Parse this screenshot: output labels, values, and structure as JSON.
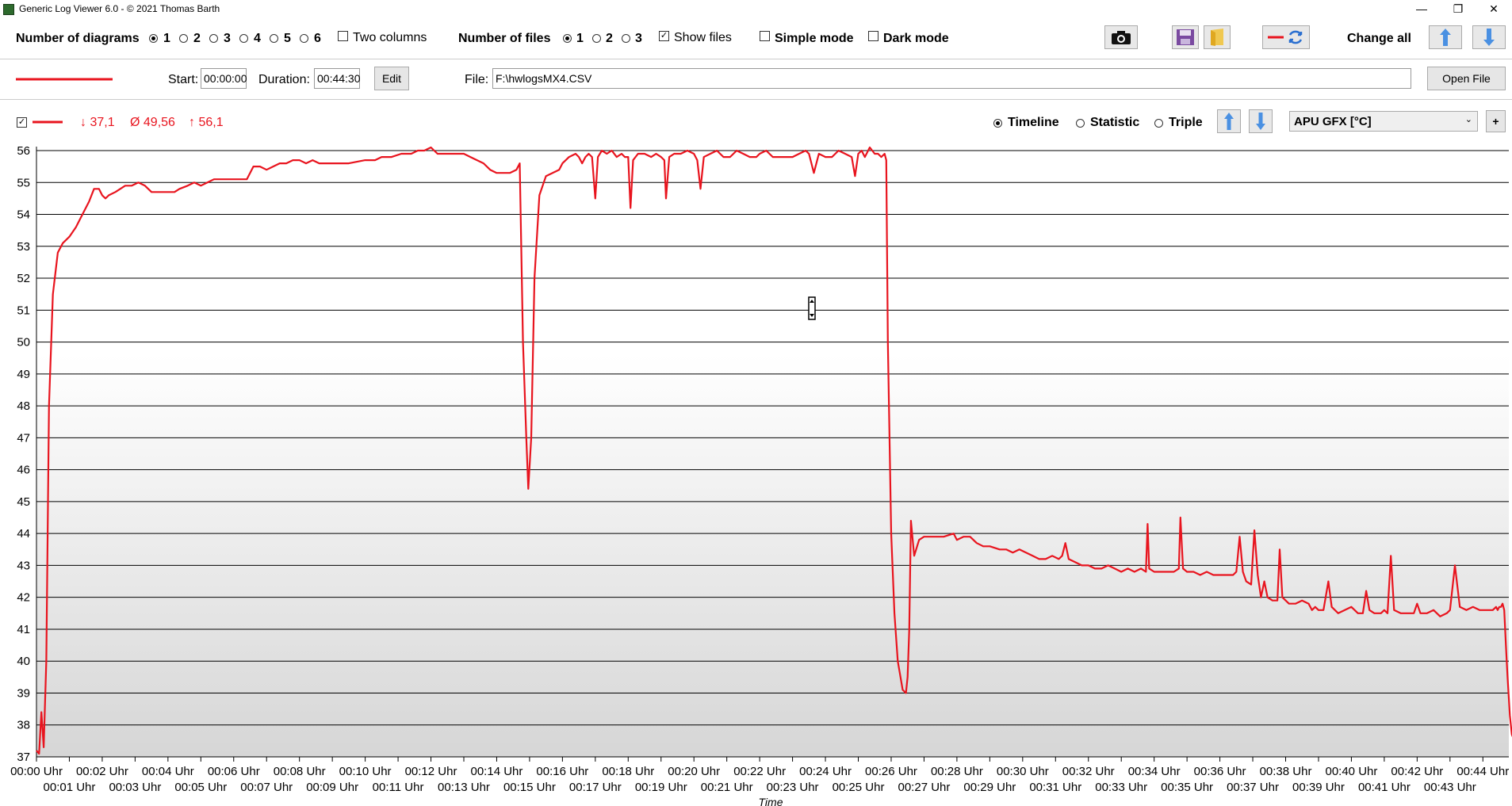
{
  "window": {
    "title": "Generic Log Viewer 6.0 - © 2021 Thomas Barth",
    "minimize": "—",
    "restore": "❐",
    "close": "✕"
  },
  "toolbar": {
    "num_diagrams_label": "Number of diagrams",
    "diagram_options": [
      "1",
      "2",
      "3",
      "4",
      "5",
      "6"
    ],
    "diagram_selected": "1",
    "two_columns_label": "Two columns",
    "num_files_label": "Number of files",
    "file_options": [
      "1",
      "2",
      "3"
    ],
    "file_selected": "1",
    "show_files_label": "Show files",
    "show_files_checked": true,
    "simple_mode_label": "Simple mode",
    "dark_mode_label": "Dark mode",
    "change_all_label": "Change all"
  },
  "file_row": {
    "start_label": "Start:",
    "start_value": "00:00:00",
    "duration_label": "Duration:",
    "duration_value": "00:44:30",
    "edit_label": "Edit",
    "file_label": "File:",
    "file_value": "F:\\hwlogsMX4.CSV",
    "open_file_label": "Open File",
    "line_color": "#e8141e"
  },
  "diagram_header": {
    "min_text": "↓ 37,1",
    "avg_text": "Ø 49,56",
    "max_text": "↑ 56,1",
    "mode_options": [
      "Timeline",
      "Statistic",
      "Triple"
    ],
    "mode_selected": "Timeline",
    "sensor_select": "APU GFX [°C]",
    "plus_label": "+"
  },
  "chart_data": {
    "type": "line",
    "xlabel": "Time",
    "ylabel": "",
    "ylim": [
      37,
      56
    ],
    "yticks": [
      "56",
      "55",
      "54",
      "53",
      "52",
      "51",
      "50",
      "49",
      "48",
      "47",
      "46",
      "45",
      "44",
      "43",
      "42",
      "41",
      "40",
      "39",
      "38",
      "37"
    ],
    "xticks_row1": [
      "00:00 Uhr",
      "00:02 Uhr",
      "00:04 Uhr",
      "00:06 Uhr",
      "00:08 Uhr",
      "00:10 Uhr",
      "00:12 Uhr",
      "00:14 Uhr",
      "00:16 Uhr",
      "00:18 Uhr",
      "00:20 Uhr",
      "00:22 Uhr",
      "00:24 Uhr",
      "00:26 Uhr",
      "00:28 Uhr",
      "00:30 Uhr",
      "00:32 Uhr",
      "00:34 Uhr",
      "00:36 Uhr",
      "00:38 Uhr",
      "00:40 Uhr",
      "00:42 Uhr",
      "00:44 Uhr"
    ],
    "xticks_row2": [
      "00:01 Uhr",
      "00:03 Uhr",
      "00:05 Uhr",
      "00:07 Uhr",
      "00:09 Uhr",
      "00:11 Uhr",
      "00:13 Uhr",
      "00:15 Uhr",
      "00:17 Uhr",
      "00:19 Uhr",
      "00:21 Uhr",
      "00:23 Uhr",
      "00:25 Uhr",
      "00:27 Uhr",
      "00:29 Uhr",
      "00:31 Uhr",
      "00:33 Uhr",
      "00:35 Uhr",
      "00:37 Uhr",
      "00:39 Uhr",
      "00:41 Uhr",
      "00:43 Uhr"
    ],
    "xlim_minutes": [
      0,
      44.5
    ],
    "grid": true,
    "series": [
      {
        "color": "#e8141e",
        "points": [
          [
            0.0,
            37.2
          ],
          [
            0.08,
            37.1
          ],
          [
            0.15,
            38.4
          ],
          [
            0.22,
            37.3
          ],
          [
            0.3,
            40
          ],
          [
            0.38,
            48
          ],
          [
            0.5,
            51.5
          ],
          [
            0.65,
            52.8
          ],
          [
            0.8,
            53.1
          ],
          [
            1.0,
            53.3
          ],
          [
            1.2,
            53.6
          ],
          [
            1.4,
            54
          ],
          [
            1.6,
            54.4
          ],
          [
            1.75,
            54.8
          ],
          [
            1.9,
            54.8
          ],
          [
            2.0,
            54.6
          ],
          [
            2.1,
            54.5
          ],
          [
            2.2,
            54.6
          ],
          [
            2.4,
            54.7
          ],
          [
            2.55,
            54.8
          ],
          [
            2.7,
            54.9
          ],
          [
            2.9,
            54.9
          ],
          [
            3.1,
            55.0
          ],
          [
            3.3,
            54.9
          ],
          [
            3.5,
            54.7
          ],
          [
            3.7,
            54.7
          ],
          [
            4.0,
            54.7
          ],
          [
            4.2,
            54.7
          ],
          [
            4.35,
            54.8
          ],
          [
            4.6,
            54.9
          ],
          [
            4.8,
            55.0
          ],
          [
            5.0,
            54.9
          ],
          [
            5.2,
            55.0
          ],
          [
            5.4,
            55.1
          ],
          [
            5.6,
            55.1
          ],
          [
            6.0,
            55.1
          ],
          [
            6.4,
            55.1
          ],
          [
            6.6,
            55.5
          ],
          [
            6.8,
            55.5
          ],
          [
            7.0,
            55.4
          ],
          [
            7.2,
            55.5
          ],
          [
            7.4,
            55.6
          ],
          [
            7.6,
            55.6
          ],
          [
            7.8,
            55.7
          ],
          [
            8.0,
            55.7
          ],
          [
            8.2,
            55.6
          ],
          [
            8.4,
            55.7
          ],
          [
            8.6,
            55.6
          ],
          [
            8.8,
            55.6
          ],
          [
            9.0,
            55.6
          ],
          [
            9.5,
            55.6
          ],
          [
            10.0,
            55.7
          ],
          [
            10.3,
            55.7
          ],
          [
            10.5,
            55.8
          ],
          [
            10.8,
            55.8
          ],
          [
            11.1,
            55.9
          ],
          [
            11.4,
            55.9
          ],
          [
            11.6,
            56.0
          ],
          [
            11.8,
            56.0
          ],
          [
            12.0,
            56.1
          ],
          [
            12.2,
            55.9
          ],
          [
            12.4,
            55.9
          ],
          [
            12.6,
            55.9
          ],
          [
            12.8,
            55.9
          ],
          [
            13.0,
            55.9
          ],
          [
            13.2,
            55.8
          ],
          [
            13.4,
            55.7
          ],
          [
            13.6,
            55.6
          ],
          [
            13.8,
            55.4
          ],
          [
            14.0,
            55.3
          ],
          [
            14.2,
            55.3
          ],
          [
            14.4,
            55.3
          ],
          [
            14.6,
            55.4
          ],
          [
            14.7,
            55.6
          ],
          [
            14.8,
            50
          ],
          [
            14.9,
            47
          ],
          [
            14.96,
            45.4
          ],
          [
            15.05,
            47
          ],
          [
            15.15,
            52
          ],
          [
            15.3,
            54.6
          ],
          [
            15.5,
            55.2
          ],
          [
            15.7,
            55.3
          ],
          [
            15.9,
            55.4
          ],
          [
            16.0,
            55.6
          ],
          [
            16.2,
            55.8
          ],
          [
            16.4,
            55.9
          ],
          [
            16.5,
            55.8
          ],
          [
            16.6,
            55.6
          ],
          [
            16.7,
            55.8
          ],
          [
            16.8,
            55.9
          ],
          [
            16.9,
            55.8
          ],
          [
            17.0,
            54.5
          ],
          [
            17.08,
            55.8
          ],
          [
            17.2,
            56.0
          ],
          [
            17.35,
            55.9
          ],
          [
            17.5,
            56.0
          ],
          [
            17.65,
            55.8
          ],
          [
            17.8,
            55.9
          ],
          [
            17.9,
            55.8
          ],
          [
            18.0,
            55.8
          ],
          [
            18.07,
            54.2
          ],
          [
            18.15,
            55.7
          ],
          [
            18.3,
            55.9
          ],
          [
            18.5,
            55.9
          ],
          [
            18.7,
            55.8
          ],
          [
            18.85,
            55.9
          ],
          [
            19.0,
            55.8
          ],
          [
            19.1,
            55.7
          ],
          [
            19.15,
            54.5
          ],
          [
            19.25,
            55.8
          ],
          [
            19.4,
            55.9
          ],
          [
            19.6,
            55.9
          ],
          [
            19.8,
            56.0
          ],
          [
            20.0,
            55.9
          ],
          [
            20.1,
            55.7
          ],
          [
            20.2,
            54.8
          ],
          [
            20.3,
            55.8
          ],
          [
            20.5,
            55.9
          ],
          [
            20.7,
            56.0
          ],
          [
            20.9,
            55.8
          ],
          [
            21.1,
            55.8
          ],
          [
            21.3,
            56.0
          ],
          [
            21.5,
            55.9
          ],
          [
            21.7,
            55.8
          ],
          [
            21.9,
            55.8
          ],
          [
            22.0,
            55.9
          ],
          [
            22.2,
            56.0
          ],
          [
            22.4,
            55.8
          ],
          [
            22.6,
            55.8
          ],
          [
            22.8,
            55.8
          ],
          [
            23.0,
            55.8
          ],
          [
            23.2,
            55.9
          ],
          [
            23.4,
            56.0
          ],
          [
            23.5,
            55.9
          ],
          [
            23.65,
            55.3
          ],
          [
            23.8,
            55.9
          ],
          [
            24.0,
            55.8
          ],
          [
            24.2,
            55.8
          ],
          [
            24.4,
            56.0
          ],
          [
            24.6,
            55.9
          ],
          [
            24.8,
            55.8
          ],
          [
            24.9,
            55.2
          ],
          [
            25.0,
            55.9
          ],
          [
            25.1,
            56.0
          ],
          [
            25.2,
            55.8
          ],
          [
            25.35,
            56.1
          ],
          [
            25.5,
            55.9
          ],
          [
            25.6,
            55.9
          ],
          [
            25.7,
            55.8
          ],
          [
            25.8,
            55.9
          ],
          [
            25.85,
            55.7
          ],
          [
            25.9,
            50
          ],
          [
            26.0,
            44
          ],
          [
            26.1,
            41.5
          ],
          [
            26.2,
            40
          ],
          [
            26.35,
            39.1
          ],
          [
            26.45,
            39.0
          ],
          [
            26.5,
            39.5
          ],
          [
            26.55,
            41
          ],
          [
            26.6,
            44.4
          ],
          [
            26.7,
            43.3
          ],
          [
            26.85,
            43.8
          ],
          [
            27.0,
            43.9
          ],
          [
            27.3,
            43.9
          ],
          [
            27.6,
            43.9
          ],
          [
            27.9,
            44.0
          ],
          [
            28.0,
            43.8
          ],
          [
            28.2,
            43.9
          ],
          [
            28.4,
            43.9
          ],
          [
            28.6,
            43.7
          ],
          [
            28.8,
            43.6
          ],
          [
            29.0,
            43.6
          ],
          [
            29.3,
            43.5
          ],
          [
            29.5,
            43.5
          ],
          [
            29.7,
            43.4
          ],
          [
            29.9,
            43.5
          ],
          [
            30.1,
            43.4
          ],
          [
            30.3,
            43.3
          ],
          [
            30.5,
            43.2
          ],
          [
            30.7,
            43.2
          ],
          [
            30.9,
            43.3
          ],
          [
            31.1,
            43.2
          ],
          [
            31.2,
            43.3
          ],
          [
            31.3,
            43.7
          ],
          [
            31.4,
            43.2
          ],
          [
            31.6,
            43.1
          ],
          [
            31.8,
            43.0
          ],
          [
            32.0,
            43.0
          ],
          [
            32.2,
            42.9
          ],
          [
            32.4,
            42.9
          ],
          [
            32.6,
            43.0
          ],
          [
            32.8,
            42.9
          ],
          [
            33.0,
            42.8
          ],
          [
            33.2,
            42.9
          ],
          [
            33.4,
            42.8
          ],
          [
            33.6,
            42.9
          ],
          [
            33.75,
            42.8
          ],
          [
            33.8,
            44.3
          ],
          [
            33.85,
            42.9
          ],
          [
            34.0,
            42.8
          ],
          [
            34.2,
            42.8
          ],
          [
            34.4,
            42.8
          ],
          [
            34.6,
            42.8
          ],
          [
            34.75,
            42.9
          ],
          [
            34.8,
            44.5
          ],
          [
            34.88,
            42.9
          ],
          [
            35.0,
            42.8
          ],
          [
            35.2,
            42.8
          ],
          [
            35.4,
            42.7
          ],
          [
            35.6,
            42.8
          ],
          [
            35.8,
            42.7
          ],
          [
            36.0,
            42.7
          ],
          [
            36.2,
            42.7
          ],
          [
            36.4,
            42.7
          ],
          [
            36.5,
            42.8
          ],
          [
            36.6,
            43.9
          ],
          [
            36.7,
            42.8
          ],
          [
            36.8,
            42.5
          ],
          [
            36.95,
            42.4
          ],
          [
            37.05,
            44.1
          ],
          [
            37.15,
            42.7
          ],
          [
            37.25,
            42.0
          ],
          [
            37.35,
            42.5
          ],
          [
            37.45,
            42.0
          ],
          [
            37.6,
            41.9
          ],
          [
            37.75,
            41.9
          ],
          [
            37.82,
            43.5
          ],
          [
            37.9,
            42.0
          ],
          [
            38.1,
            41.8
          ],
          [
            38.3,
            41.8
          ],
          [
            38.5,
            41.9
          ],
          [
            38.7,
            41.8
          ],
          [
            38.8,
            41.6
          ],
          [
            38.9,
            41.7
          ],
          [
            39.0,
            41.6
          ],
          [
            39.15,
            41.6
          ],
          [
            39.3,
            42.5
          ],
          [
            39.4,
            41.7
          ],
          [
            39.6,
            41.5
          ],
          [
            39.8,
            41.6
          ],
          [
            40.0,
            41.7
          ],
          [
            40.2,
            41.5
          ],
          [
            40.35,
            41.5
          ],
          [
            40.45,
            42.2
          ],
          [
            40.55,
            41.6
          ],
          [
            40.7,
            41.5
          ],
          [
            40.9,
            41.5
          ],
          [
            41.0,
            41.6
          ],
          [
            41.1,
            41.5
          ],
          [
            41.2,
            43.3
          ],
          [
            41.3,
            41.6
          ],
          [
            41.5,
            41.5
          ],
          [
            41.7,
            41.5
          ],
          [
            41.9,
            41.5
          ],
          [
            42.0,
            41.8
          ],
          [
            42.1,
            41.5
          ],
          [
            42.3,
            41.5
          ],
          [
            42.5,
            41.6
          ],
          [
            42.7,
            41.4
          ],
          [
            42.9,
            41.5
          ],
          [
            43.0,
            41.6
          ],
          [
            43.15,
            43.0
          ],
          [
            43.3,
            41.7
          ],
          [
            43.5,
            41.6
          ],
          [
            43.7,
            41.7
          ],
          [
            43.9,
            41.6
          ],
          [
            44.1,
            41.6
          ],
          [
            44.3,
            41.6
          ],
          [
            44.4,
            41.7
          ],
          [
            44.45,
            41.6
          ],
          [
            44.5,
            41.7
          ],
          [
            44.55,
            41.7
          ],
          [
            44.6,
            41.8
          ],
          [
            44.65,
            41.6
          ],
          [
            44.7,
            40.5
          ],
          [
            44.75,
            39.5
          ],
          [
            44.82,
            38.3
          ],
          [
            44.88,
            37.7
          ],
          [
            44.92,
            37.6
          ]
        ]
      }
    ]
  }
}
